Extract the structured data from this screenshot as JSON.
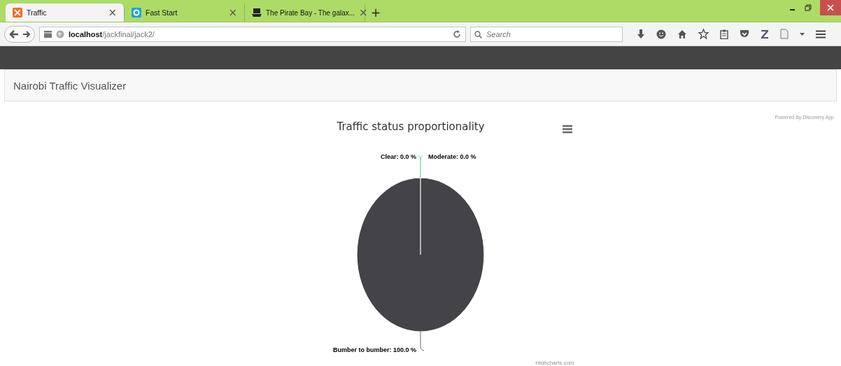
{
  "browser": {
    "tabs": [
      {
        "title": "Traffic",
        "selected": true,
        "close": "×"
      },
      {
        "title": "Fast Start",
        "selected": false,
        "close": "×"
      },
      {
        "title": "The Pirate Bay - The galax...",
        "selected": false,
        "close": "×"
      }
    ],
    "new_tab": "+",
    "url_host": "localhost",
    "url_path": "/jackfinal/jack2/",
    "search": {
      "placeholder": "Search"
    }
  },
  "navbar": {
    "brand": "Nairobi Traffic Visualizer"
  },
  "credit": "Powered By Discovery App",
  "chart": {
    "chart_data": {
      "type": "pie",
      "title": "Traffic status proportionality",
      "categories": [
        "Clear",
        "Moderate",
        "Bumber to bumber"
      ],
      "values": [
        0.0,
        0.0,
        100.0
      ],
      "data_labels": true,
      "value_labels": [
        "0.0 %",
        "0.0 %",
        "100.0 %"
      ]
    },
    "label_separator": ":",
    "footer": "Highcharts.com"
  }
}
